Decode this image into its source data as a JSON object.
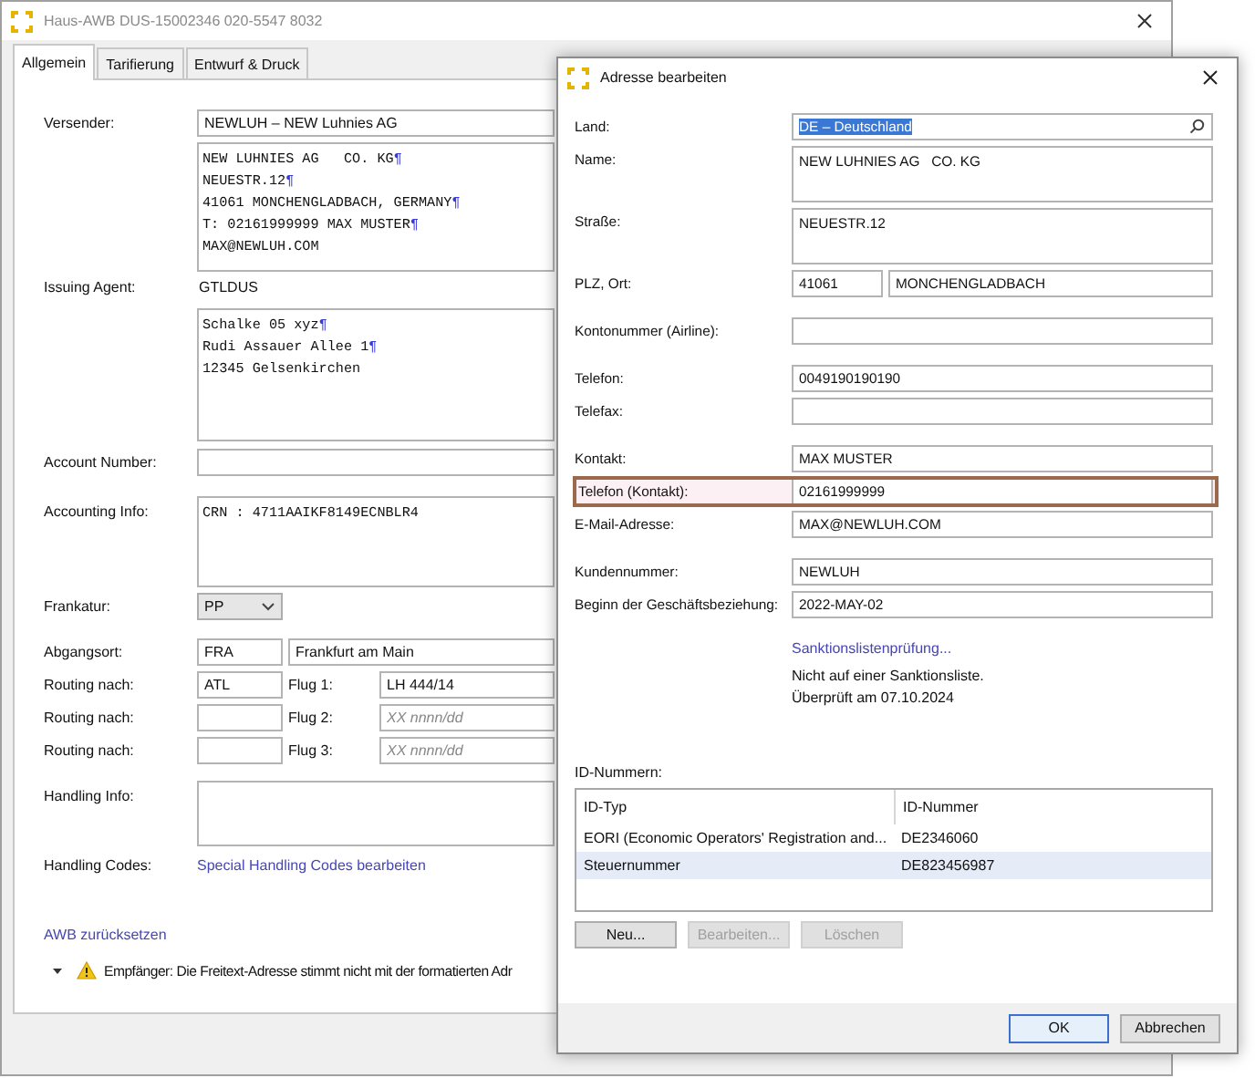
{
  "main_window": {
    "title": "Haus-AWB DUS-15002346 020-5547 8032",
    "tabs": [
      {
        "label": "Allgemein",
        "selected": true
      },
      {
        "label": "Tarifierung",
        "selected": false
      },
      {
        "label": "Entwurf & Druck",
        "selected": false
      }
    ],
    "sender": {
      "label": "Versender:",
      "value": "NEWLUH – NEW Luhnies AG",
      "address_lines": [
        {
          "text": "NEW LUHNIES AG   CO. KG",
          "end_mark": "¶"
        },
        {
          "text": "NEUESTR.12",
          "end_mark": "¶"
        },
        {
          "text": "41061 MONCHENGLADBACH, GERMANY",
          "end_mark": "¶"
        },
        {
          "text": "T: 02161999999 MAX MUSTER",
          "end_mark": "¶"
        },
        {
          "text": "MAX@NEWLUH.COM"
        }
      ]
    },
    "issuing_agent": {
      "label": "Issuing Agent:",
      "value": "GTLDUS",
      "address_lines": [
        {
          "text": "Schalke 05 xyz",
          "end_mark": "¶"
        },
        {
          "text": "Rudi Assauer Allee 1",
          "end_mark": "¶"
        },
        {
          "text": "12345 Gelsenkirchen"
        }
      ]
    },
    "account_number": {
      "label": "Account Number:"
    },
    "accounting_info": {
      "label": "Accounting Info:",
      "lines": [
        {
          "text": "CRN : 4711AAIKF8149ECNBLR4"
        }
      ]
    },
    "frankatur": {
      "label": "Frankatur:",
      "value": "PP"
    },
    "departure": {
      "label": "Abgangsort:",
      "code": "FRA",
      "name": "Frankfurt am Main"
    },
    "routing": [
      {
        "label": "Routing nach:",
        "airport": "ATL",
        "flight_label": "Flug 1:",
        "flight": "LH 444/14"
      },
      {
        "label": "Routing nach:",
        "flight_label": "Flug 2:",
        "flight_placeholder": "XX nnnn/dd"
      },
      {
        "label": "Routing nach:",
        "flight_label": "Flug 3:",
        "flight_placeholder": "XX nnnn/dd"
      }
    ],
    "handling_info": {
      "label": "Handling Info:"
    },
    "handling_codes": {
      "label": "Handling Codes:",
      "link": "Special Handling Codes bearbeiten"
    },
    "reset_link": "AWB zurücksetzen",
    "warning": "Empfänger: Die Freitext-Adresse stimmt nicht mit der formatierten Adr"
  },
  "dialog": {
    "title": "Adresse bearbeiten",
    "field_groups": [
      [
        {
          "kind": "search",
          "label": "Land:",
          "value": "DE – Deutschland",
          "highlighted": false
        },
        {
          "kind": "area",
          "label": "Name:",
          "value": "NEW LUHNIES AG   CO. KG",
          "highlighted": false
        },
        {
          "kind": "area",
          "label": "Straße:",
          "value": "NEUESTR.12",
          "highlighted": false
        },
        {
          "kind": "pair",
          "label": "PLZ, Ort:",
          "value": "41061",
          "value_2": "MONCHENGLADBACH",
          "highlighted": false
        }
      ],
      [
        {
          "kind": "line",
          "label": "Kontonummer (Airline):",
          "highlighted": false
        }
      ],
      [
        {
          "kind": "line",
          "label": "Telefon:",
          "value": "0049190190190",
          "highlighted": false
        },
        {
          "kind": "line",
          "label": "Telefax:",
          "highlighted": false
        }
      ],
      [
        {
          "kind": "line",
          "label": "Kontakt:",
          "value": "MAX MUSTER",
          "highlighted": false
        },
        {
          "kind": "line",
          "label": "Telefon (Kontakt):",
          "value": "02161999999",
          "highlighted": true
        },
        {
          "kind": "line",
          "label": "E-Mail-Adresse:",
          "value": "MAX@NEWLUH.COM",
          "highlighted": false
        }
      ],
      [
        {
          "kind": "line",
          "label": "Kundennummer:",
          "value": "NEWLUH",
          "highlighted": false
        },
        {
          "kind": "line",
          "label": "Beginn der Geschäftsbeziehung:",
          "value": "2022-MAY-02",
          "highlighted": false
        }
      ]
    ],
    "sanctions_link": "Sanktionslistenprüfung...",
    "sanctions_status": [
      "Nicht auf einer Sanktionsliste.",
      "Überprüft am 07.10.2024"
    ],
    "id_label": "ID-Nummern:",
    "id_table": {
      "columns": [
        "ID-Typ",
        "ID-Nummer"
      ],
      "rows": [
        {
          "cells": [
            "EORI (Economic Operators' Registration and...",
            "DE2346060"
          ],
          "selected": false
        },
        {
          "cells": [
            "Steuernummer",
            "DE823456987"
          ],
          "selected": true
        }
      ]
    },
    "table_buttons": [
      {
        "label": "Neu...",
        "disabled": false
      },
      {
        "label": "Bearbeiten...",
        "disabled": true
      },
      {
        "label": "Löschen",
        "disabled": true
      }
    ],
    "footer_buttons": [
      {
        "label": "OK",
        "default": true
      },
      {
        "label": "Abbrechen",
        "default": false
      }
    ]
  }
}
